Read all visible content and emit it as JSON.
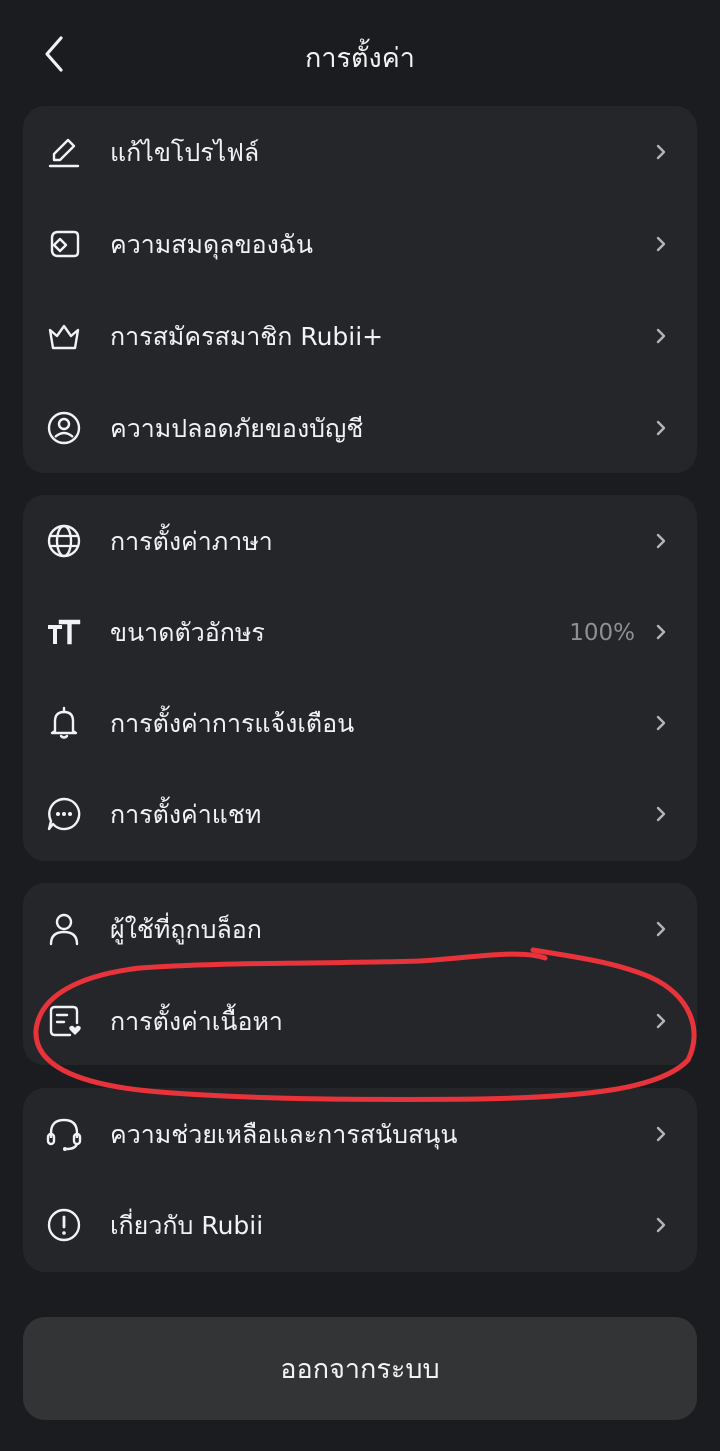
{
  "header": {
    "title": "การตั้งค่า",
    "back_icon": "chevron-left-icon"
  },
  "groups": [
    {
      "items": [
        {
          "label": "แก้ไขโปรไฟล์",
          "icon": "edit-pencil-icon"
        },
        {
          "label": "ความสมดุลของฉัน",
          "icon": "wallet-diamond-icon"
        },
        {
          "label": "การสมัครสมาชิก Rubii+",
          "icon": "crown-icon"
        },
        {
          "label": "ความปลอดภัยของบัญชี",
          "icon": "account-icon"
        }
      ]
    },
    {
      "items": [
        {
          "label": "การตั้งค่าภาษา",
          "icon": "globe-icon"
        },
        {
          "label": "ขนาดตัวอักษร",
          "icon": "font-size-icon",
          "value": "100%"
        },
        {
          "label": "การตั้งค่าการแจ้งเตือน",
          "icon": "bell-icon"
        },
        {
          "label": "การตั้งค่าแชท",
          "icon": "chat-icon"
        }
      ]
    },
    {
      "items": [
        {
          "label": "ผู้ใช้ที่ถูกบล็อก",
          "icon": "user-icon"
        },
        {
          "label": "การตั้งค่าเนื้อหา",
          "icon": "content-heart-icon"
        }
      ]
    },
    {
      "items": [
        {
          "label": "ความช่วยเหลือและการสนับสนุน",
          "icon": "headset-icon"
        },
        {
          "label": "เกี่ยวกับ Rubii",
          "icon": "info-exclamation-icon"
        }
      ]
    }
  ],
  "logout": {
    "label": "ออกจากระบบ"
  },
  "colors": {
    "background": "#1b1c1f",
    "card": "#25262a",
    "logout_button": "#333436",
    "annotation": "#e8333a",
    "secondary_text": "#8e8f95"
  }
}
